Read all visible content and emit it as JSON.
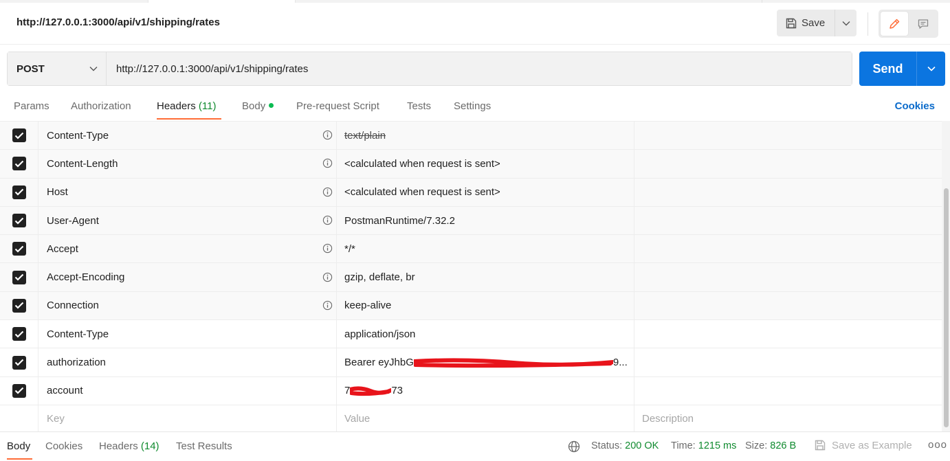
{
  "request": {
    "name": "http://127.0.0.1:3000/api/v1/shipping/rates",
    "method": "POST",
    "url": "http://127.0.0.1:3000/api/v1/shipping/rates"
  },
  "toolbar": {
    "save_label": "Save",
    "send_label": "Send"
  },
  "tabs": {
    "params": "Params",
    "authorization": "Authorization",
    "headers": "Headers",
    "headers_count": "(11)",
    "body": "Body",
    "prerequest": "Pre-request Script",
    "tests": "Tests",
    "settings": "Settings",
    "cookies": "Cookies"
  },
  "headers": [
    {
      "key": "Content-Type",
      "value": "text/plain",
      "auto": true,
      "struck": true
    },
    {
      "key": "Content-Length",
      "value": "<calculated when request is sent>",
      "auto": true
    },
    {
      "key": "Host",
      "value": "<calculated when request is sent>",
      "auto": true
    },
    {
      "key": "User-Agent",
      "value": "PostmanRuntime/7.32.2",
      "auto": true
    },
    {
      "key": "Accept",
      "value": "*/*",
      "auto": true
    },
    {
      "key": "Accept-Encoding",
      "value": "gzip, deflate, br",
      "auto": true
    },
    {
      "key": "Connection",
      "value": "keep-alive",
      "auto": true
    },
    {
      "key": "Content-Type",
      "value": "application/json",
      "auto": false
    },
    {
      "key": "authorization",
      "value": "Bearer eyJhbG",
      "value_tail": "9...",
      "auto": false,
      "redacted": true
    },
    {
      "key": "account",
      "value": "7",
      "value_tail": "73",
      "auto": false,
      "redacted": true
    }
  ],
  "new_row": {
    "key_placeholder": "Key",
    "value_placeholder": "Value",
    "description_placeholder": "Description"
  },
  "response": {
    "tabs": {
      "body": "Body",
      "cookies": "Cookies",
      "headers": "Headers",
      "headers_count": "(14)",
      "test_results": "Test Results"
    },
    "status_label": "Status:",
    "status_value": "200 OK",
    "time_label": "Time:",
    "time_value": "1215 ms",
    "size_label": "Size:",
    "size_value": "826 B",
    "save_example": "Save as Example",
    "more": "ooo"
  },
  "colors": {
    "accent": "#ff6c37",
    "send": "#0b75e0",
    "ok_green": "#0f8a2e",
    "redaction": "#e8141b"
  },
  "icons": [
    "save-icon",
    "chevron-down-icon",
    "pencil-icon",
    "comment-icon",
    "info-icon",
    "check-icon",
    "globe-icon"
  ]
}
